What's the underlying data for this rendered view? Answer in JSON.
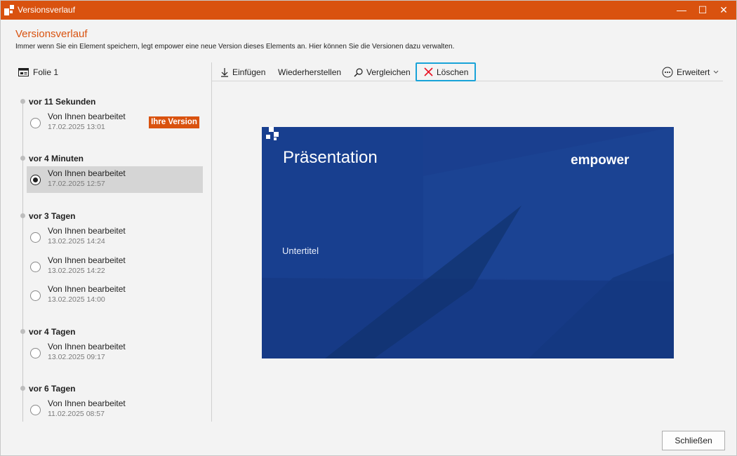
{
  "window": {
    "title": "Versionsverlauf",
    "controls": {
      "minimize": "—",
      "maximize": "☐",
      "close": "✕"
    }
  },
  "header": {
    "title": "Versionsverlauf",
    "description": "Immer wenn Sie ein Element speichern, legt empower eine neue Version dieses Elements an. Hier können Sie die Versionen dazu verwalten."
  },
  "element": {
    "icon": "slide-icon",
    "label": "Folie 1"
  },
  "toolbar": {
    "insert_label": "Einfügen",
    "restore_label": "Wiederherstellen",
    "compare_label": "Vergleichen",
    "delete_label": "Löschen",
    "advanced_label": "Erweitert",
    "accent_color": "#19a3d8",
    "delete_icon_color": "#e81123"
  },
  "timeline": {
    "groups": [
      {
        "label": "vor 11 Sekunden",
        "versions": [
          {
            "title": "Von Ihnen bearbeitet",
            "date": "17.02.2025 13:01",
            "badge": "Ihre Version",
            "selected": false
          }
        ]
      },
      {
        "label": "vor 4 Minuten",
        "versions": [
          {
            "title": "Von Ihnen bearbeitet",
            "date": "17.02.2025 12:57",
            "selected": true
          }
        ]
      },
      {
        "label": "vor 3 Tagen",
        "versions": [
          {
            "title": "Von Ihnen bearbeitet",
            "date": "13.02.2025 14:24",
            "selected": false
          },
          {
            "title": "Von Ihnen bearbeitet",
            "date": "13.02.2025 14:22",
            "selected": false
          },
          {
            "title": "Von Ihnen bearbeitet",
            "date": "13.02.2025 14:00",
            "selected": false
          }
        ]
      },
      {
        "label": "vor 4 Tagen",
        "versions": [
          {
            "title": "Von Ihnen bearbeitet",
            "date": "13.02.2025 09:17",
            "selected": false
          }
        ]
      },
      {
        "label": "vor 6 Tagen",
        "versions": [
          {
            "title": "Von Ihnen bearbeitet",
            "date": "11.02.2025 08:57",
            "selected": false
          }
        ]
      }
    ]
  },
  "preview": {
    "title": "Präsentation",
    "subtitle": "Untertitel",
    "brand": "empower",
    "background_color": "#1a3f8f"
  },
  "footer": {
    "close_label": "Schließen"
  },
  "colors": {
    "brand_orange": "#d9520f"
  }
}
